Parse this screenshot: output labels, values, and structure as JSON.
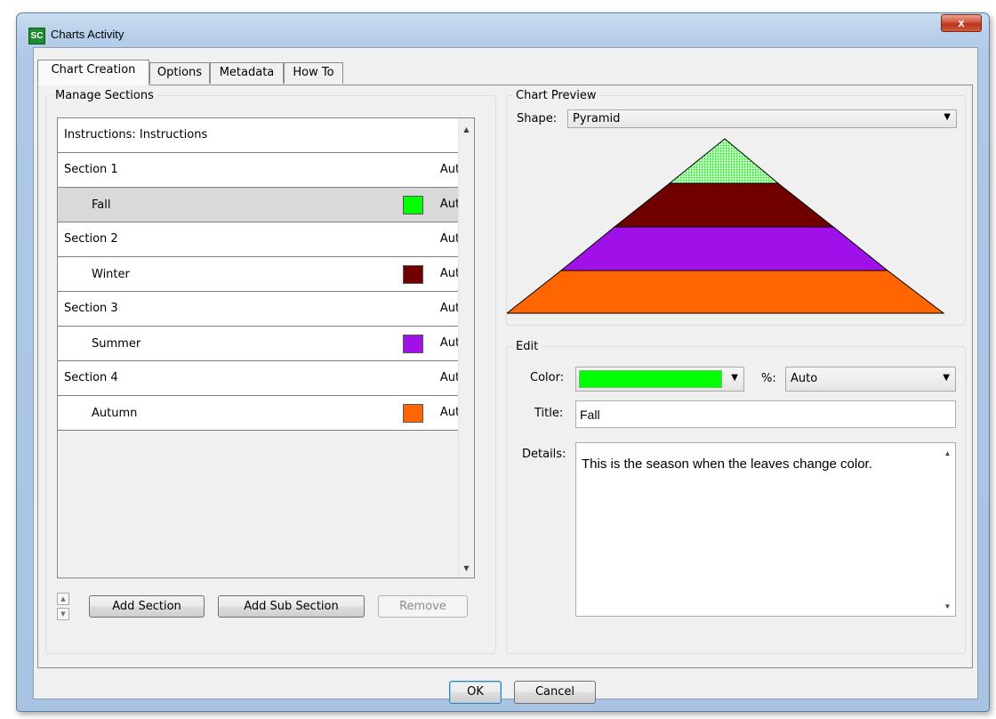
{
  "window": {
    "icon_label": "SC",
    "title": "Charts Activity",
    "close_glyph": "x"
  },
  "tabs": [
    {
      "label": "Chart Creation",
      "active": true
    },
    {
      "label": "Options",
      "active": false
    },
    {
      "label": "Metadata",
      "active": false
    },
    {
      "label": "How To",
      "active": false
    }
  ],
  "manage_sections": {
    "legend": "Manage Sections",
    "rows": [
      {
        "label": "Instructions: Instructions",
        "value": "",
        "sub": false
      },
      {
        "label": "Section 1",
        "value": "Auto",
        "sub": false
      },
      {
        "label": "Fall",
        "value": "Auto",
        "sub": true,
        "color": "#00ff00",
        "selected": true
      },
      {
        "label": "Section 2",
        "value": "Auto",
        "sub": false
      },
      {
        "label": "Winter",
        "value": "Auto",
        "sub": true,
        "color": "#700000"
      },
      {
        "label": "Section 3",
        "value": "Auto",
        "sub": false
      },
      {
        "label": "Summer",
        "value": "Auto",
        "sub": true,
        "color": "#a010e8"
      },
      {
        "label": "Section 4",
        "value": "Auto",
        "sub": false
      },
      {
        "label": "Autumn",
        "value": "Auto",
        "sub": true,
        "color": "#ff6600"
      }
    ],
    "buttons": {
      "add_section": "Add Section",
      "add_sub_section": "Add Sub Section",
      "remove": "Remove"
    }
  },
  "chart_preview": {
    "legend": "Chart Preview",
    "shape_label": "Shape:",
    "shape_value": "Pyramid",
    "layers_top_to_bottom": [
      {
        "name": "Fall",
        "color": "#00ff00",
        "hatched": true
      },
      {
        "name": "Winter",
        "color": "#700000"
      },
      {
        "name": "Summer",
        "color": "#a010e8"
      },
      {
        "name": "Autumn",
        "color": "#ff6600"
      }
    ]
  },
  "edit": {
    "legend": "Edit",
    "color_label": "Color:",
    "color_value": "#00ff00",
    "percent_label": "%:",
    "percent_value": "Auto",
    "title_label": "Title:",
    "title_value": "Fall",
    "details_label": "Details:",
    "details_value": "This is the season when the leaves change color."
  },
  "footer": {
    "ok": "OK",
    "cancel": "Cancel"
  }
}
